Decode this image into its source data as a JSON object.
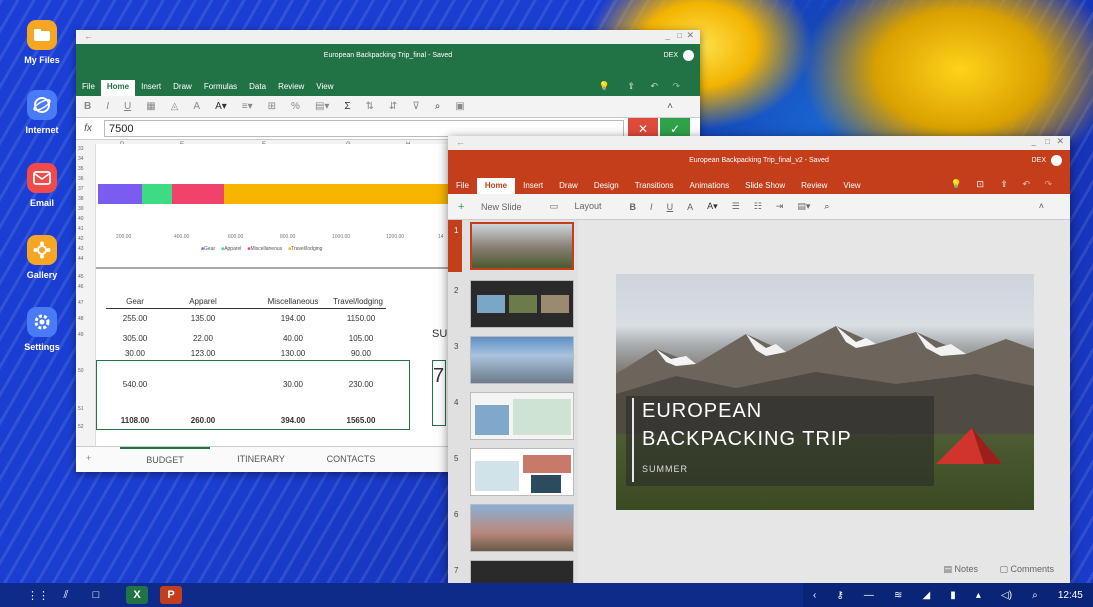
{
  "sidebar": {
    "apps": [
      {
        "label": "My Files",
        "icon": "folder-icon",
        "color": "#f5a623"
      },
      {
        "label": "Internet",
        "icon": "internet-icon",
        "color": "#4a7bf7"
      },
      {
        "label": "Email",
        "icon": "email-icon",
        "color": "#f04a4a"
      },
      {
        "label": "Gallery",
        "icon": "gallery-icon",
        "color": "#f5a623"
      },
      {
        "label": "Settings",
        "icon": "gear-icon",
        "color": "#4a7bf7"
      }
    ]
  },
  "excel": {
    "window_title": "European Backpacking Trip_final - Saved",
    "user": "DEX",
    "tabs": [
      "File",
      "Home",
      "Insert",
      "Draw",
      "Formulas",
      "Data",
      "Review",
      "View"
    ],
    "active_tab": "Home",
    "formula_label": "fx",
    "formula_value": "7500",
    "columns": [
      "D",
      "E",
      "F",
      "G",
      "H"
    ],
    "chart": {
      "axis_ticks": [
        "200.00",
        "400.00",
        "600.00",
        "800.00",
        "1000.00",
        "1200.00",
        "14"
      ],
      "legend": [
        "Gear",
        "Apparel",
        "Miscellaneous",
        "Travel/lodging"
      ],
      "legend_colors": [
        "#7b5cf0",
        "#3ddc84",
        "#f0426a",
        "#f7b500"
      ]
    },
    "table": {
      "headers": [
        "Gear",
        "Apparel",
        "Miscellaneous",
        "Travel/lodging"
      ],
      "rows": [
        [
          "255.00",
          "135.00",
          "194.00",
          "1150.00"
        ],
        [
          "305.00",
          "22.00",
          "40.00",
          "105.00"
        ],
        [
          "30.00",
          "123.00",
          "130.00",
          "90.00"
        ],
        [
          "540.00",
          "",
          "30.00",
          "230.00"
        ],
        [
          "1108.00",
          "260.00",
          "394.00",
          "1565.00"
        ]
      ]
    },
    "side_fragment": {
      "label1": "SU",
      "label2": "7"
    },
    "sheet_tabs": [
      "BUDGET",
      "ITINERARY",
      "CONTACTS"
    ],
    "row_numbers": [
      "33",
      "34",
      "35",
      "36",
      "37",
      "38",
      "39",
      "40",
      "41",
      "42",
      "43",
      "44",
      "45",
      "46",
      "47",
      "48",
      "49",
      "50",
      "51",
      "52"
    ]
  },
  "ppt": {
    "window_title": "European Backpacking Trip_final_v2 - Saved",
    "user": "DEX",
    "tabs": [
      "File",
      "Home",
      "Insert",
      "Draw",
      "Design",
      "Transitions",
      "Animations",
      "Slide Show",
      "Review",
      "View"
    ],
    "active_tab": "Home",
    "tools": {
      "new_slide": "New Slide",
      "layout": "Layout"
    },
    "slide_numbers": [
      "1",
      "2",
      "3",
      "4",
      "5",
      "6",
      "7"
    ],
    "slide": {
      "title_line1": "EUROPEAN",
      "title_line2": "BACKPACKING TRIP",
      "subtitle": "SUMMER"
    },
    "status": {
      "notes": "Notes",
      "comments": "Comments"
    }
  },
  "taskbar": {
    "time": "12:45"
  }
}
